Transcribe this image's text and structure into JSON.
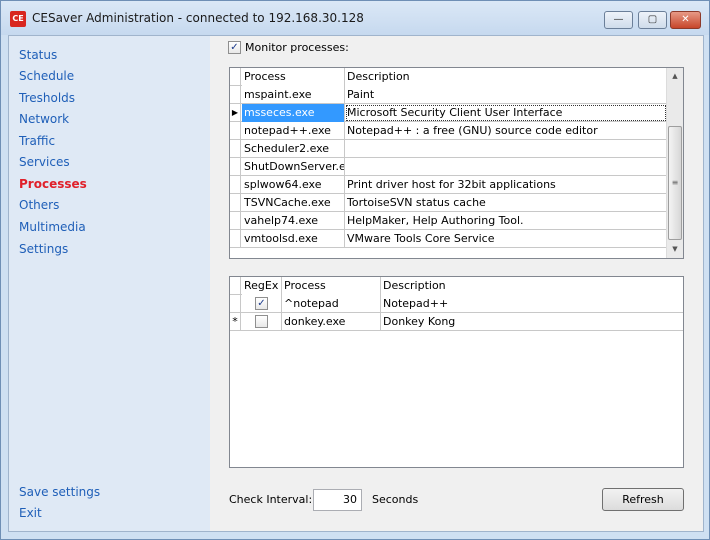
{
  "window": {
    "app_icon": "CE",
    "title": "CESaver Administration - connected to 192.168.30.128",
    "min_icon": "minimize-icon",
    "max_icon": "maximize-icon",
    "close_icon": "close-icon",
    "min_glyph": "—",
    "max_glyph": "▢",
    "close_glyph": "✕"
  },
  "sidebar": {
    "items": [
      {
        "label": "Status"
      },
      {
        "label": "Schedule"
      },
      {
        "label": "Tresholds"
      },
      {
        "label": "Network"
      },
      {
        "label": "Traffic"
      },
      {
        "label": "Services"
      },
      {
        "label": "Processes",
        "active": true
      },
      {
        "label": "Others"
      },
      {
        "label": "Multimedia"
      },
      {
        "label": "Settings"
      }
    ],
    "save_label": "Save settings",
    "exit_label": "Exit",
    "link_color": "#1f5fb8",
    "active_color": "#e0202a"
  },
  "monitor": {
    "label": "Monitor processes:",
    "checked": true
  },
  "process_grid": {
    "columns": [
      "Process",
      "Description"
    ],
    "current_row_marker": "▶",
    "rows": [
      {
        "process": "mspaint.exe",
        "description": "Paint"
      },
      {
        "process": "msseces.exe",
        "description": "Microsoft Security Client User Interface",
        "selected": true
      },
      {
        "process": "notepad++.exe",
        "description": "Notepad++ : a free (GNU) source code editor"
      },
      {
        "process": "Scheduler2.exe",
        "description": ""
      },
      {
        "process": "ShutDownServer.exe",
        "description": ""
      },
      {
        "process": "splwow64.exe",
        "description": "Print driver host for 32bit applications"
      },
      {
        "process": "TSVNCache.exe",
        "description": "TortoiseSVN status cache"
      },
      {
        "process": "vahelp74.exe",
        "description": "HelpMaker, Help Authoring Tool."
      },
      {
        "process": "vmtoolsd.exe",
        "description": "VMware Tools Core Service"
      }
    ],
    "scroll_up": "▲",
    "scroll_down": "▼",
    "scroll_grip": "≡"
  },
  "rule_grid": {
    "columns": [
      "RegEx",
      "Process",
      "Description"
    ],
    "new_row_marker": "*",
    "rows": [
      {
        "regex": true,
        "process": "^notepad",
        "description": "Notepad++"
      },
      {
        "regex": false,
        "process": "donkey.exe",
        "description": "Donkey Kong",
        "new": true
      }
    ]
  },
  "footer": {
    "interval_label": "Check Interval:",
    "interval_value": "30",
    "interval_unit": "Seconds",
    "refresh_label": "Refresh"
  }
}
